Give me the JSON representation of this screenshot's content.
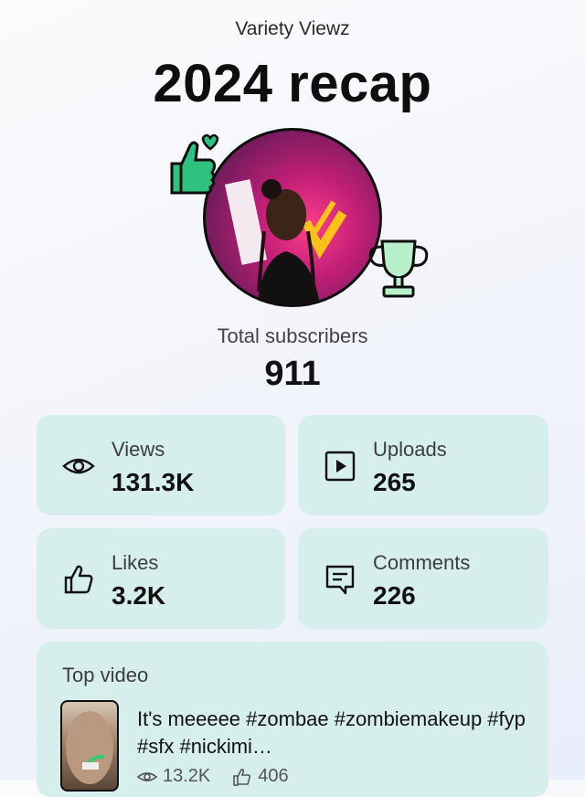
{
  "header": {
    "channel_name": "Variety Viewz",
    "title": "2024 recap"
  },
  "subscribers": {
    "label": "Total subscribers",
    "value": "911"
  },
  "stats": {
    "views": {
      "label": "Views",
      "value": "131.3K",
      "icon": "eye-icon"
    },
    "uploads": {
      "label": "Uploads",
      "value": "265",
      "icon": "play-box-icon"
    },
    "likes": {
      "label": "Likes",
      "value": "3.2K",
      "icon": "thumbs-up-icon"
    },
    "comments": {
      "label": "Comments",
      "value": "226",
      "icon": "comment-icon"
    }
  },
  "top_video": {
    "label": "Top video",
    "title": "It's meeeee #zombae #zombiemakeup #fyp #sfx #nickimi…",
    "views": "13.2K",
    "likes": "406"
  },
  "colors": {
    "card_bg": "#d6eeec",
    "sticker_green": "#2ec27e",
    "sticker_mint": "#b8f0c9"
  }
}
